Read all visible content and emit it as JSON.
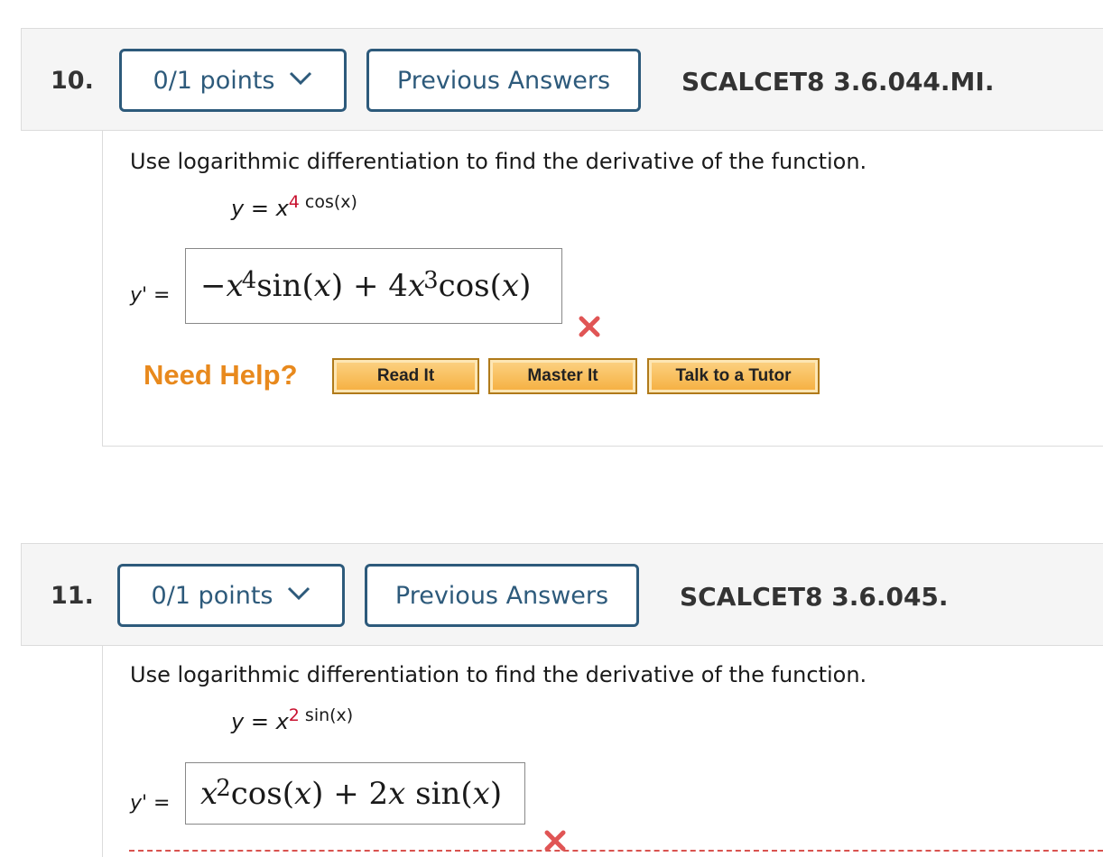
{
  "questions": [
    {
      "number": "10.",
      "points_label": "0/1 points",
      "previous_answers_label": "Previous Answers",
      "assignment_id": "SCALCET8 3.6.044.MI.",
      "prompt": "Use logarithmic differentiation to find the derivative of the function.",
      "function": {
        "lhs": "y",
        "eq": " = ",
        "base": "x",
        "exp_red": "4",
        "exp_rest": " cos(x)"
      },
      "answer_label": "y' =",
      "answer": {
        "neg": "−",
        "x1": "x",
        "e1": "4",
        "sin": "sin",
        "p1": "(",
        "v1": "x",
        "p2": ")",
        "plus": " + 4",
        "x2": "x",
        "e2": "3",
        "cos": "cos",
        "p3": "(",
        "v2": "x",
        "p4": ")"
      },
      "result": "incorrect",
      "help": {
        "label": "Need Help?",
        "read": "Read It",
        "master": "Master It",
        "tutor": "Talk to a Tutor"
      }
    },
    {
      "number": "11.",
      "points_label": "0/1 points",
      "previous_answers_label": "Previous Answers",
      "assignment_id": "SCALCET8 3.6.045.",
      "prompt": "Use logarithmic differentiation to find the derivative of the function.",
      "function": {
        "lhs": "y",
        "eq": " = ",
        "base": "x",
        "exp_red": "2",
        "exp_rest": " sin(x)"
      },
      "answer_label": "y' =",
      "answer": {
        "x1": "x",
        "e1": "2",
        "cos": "cos",
        "p1": "(",
        "v1": "x",
        "p2": ")",
        "plus": " + 2",
        "x2": "x",
        "sin": " sin",
        "p3": "(",
        "v3": "x",
        "p4": ")"
      },
      "result": "incorrect"
    }
  ],
  "colors": {
    "accent": "#2d5a7b",
    "error": "#c8102e",
    "help": "#e8891d",
    "help_button": "#f5ae3e"
  },
  "icons": {
    "chevron": "chevron-down-icon",
    "incorrect": "red-x-icon"
  }
}
